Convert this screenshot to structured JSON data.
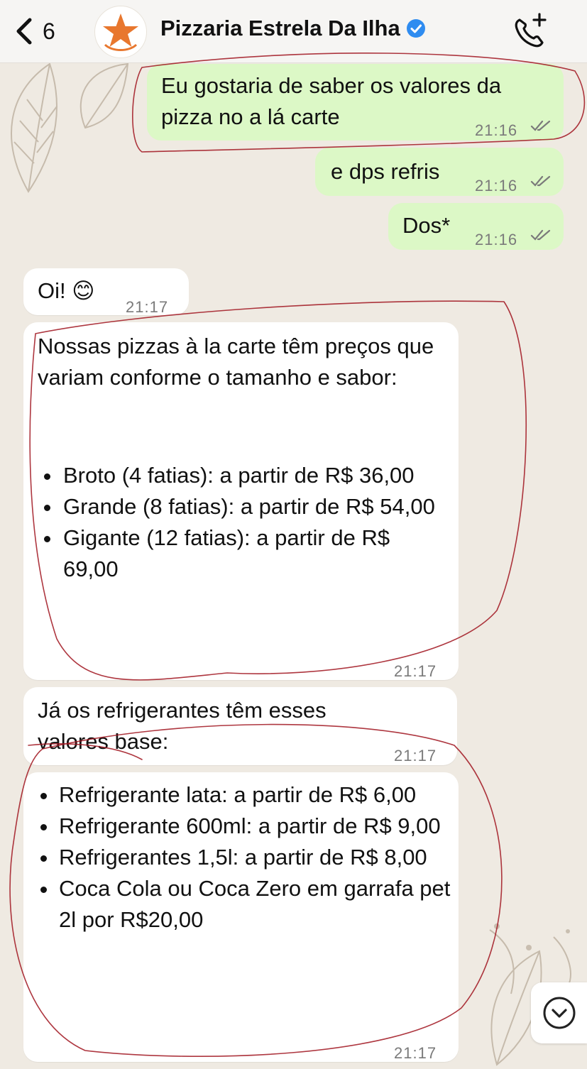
{
  "header": {
    "back_count": "6",
    "contact_name": "Pizzaria Estrela Da Ilha"
  },
  "messages": {
    "out1": {
      "text": "Eu gostaria de saber os valores da pizza no a lá carte",
      "time": "21:16"
    },
    "out2": {
      "text": "e dps refris",
      "time": "21:16"
    },
    "out3": {
      "text": "Dos*",
      "time": "21:16"
    },
    "in1": {
      "text": "Oi! 😊",
      "time": "21:17"
    },
    "in2": {
      "intro": "Nossas pizzas à la carte têm preços que variam conforme o tamanho e sabor:",
      "items": [
        "Broto (4 fatias): a partir de R$ 36,00",
        "Grande (8 fatias): a partir de R$ 54,00",
        "Gigante (12 fatias): a partir de R$ 69,00"
      ],
      "time": "21:17"
    },
    "in3": {
      "text": "Já os refrigerantes têm esses valores base:",
      "time": "21:17"
    },
    "in4": {
      "items": [
        "Refrigerante lata: a partir de R$ 6,00",
        "Refrigerante 600ml: a partir de R$ 9,00",
        "Refrigerantes 1,5l: a partir de R$ 8,00",
        "Coca Cola ou Coca Zero em garrafa pet 2l por R$20,00"
      ],
      "time": "21:17"
    }
  },
  "colors": {
    "outgoing_bubble": "#dcf8c6",
    "incoming_bubble": "#ffffff",
    "chat_background": "#efeae2",
    "annotation_red": "#a0141e",
    "avatar_star": "#e8772e"
  },
  "icons": {
    "back": "chevron-left-icon",
    "verified": "verified-badge-icon",
    "call": "phone-add-icon",
    "scroll": "chevron-down-circle-icon"
  }
}
